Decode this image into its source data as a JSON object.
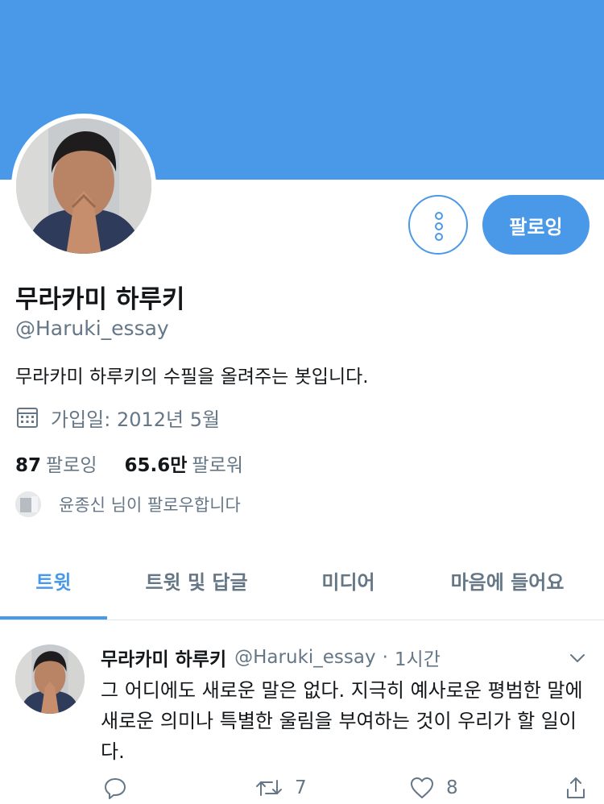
{
  "profile": {
    "name": "무라카미 하루키",
    "handle": "@Haruki_essay",
    "bio": "무라카미 하루키의 수필을 올려주는 봇입니다.",
    "joined": "가입일: 2012년 5월",
    "following_count": "87",
    "following_label": "팔로잉",
    "followers_count": "65.6만",
    "followers_label": "팔로워",
    "followed_by": "윤종신 님이 팔로우합니다"
  },
  "actions": {
    "follow_button": "팔로잉"
  },
  "tabs": [
    {
      "label": "트윗",
      "active": true
    },
    {
      "label": "트윗 및 답글",
      "active": false
    },
    {
      "label": "미디어",
      "active": false
    },
    {
      "label": "마음에 들어요",
      "active": false
    }
  ],
  "tweet": {
    "name": "무라카미 하루키",
    "handle": "@Haruki_essay",
    "separator": "·",
    "time": "1시간",
    "text": "그 어디에도 새로운 말은 없다. 지극히 예사로운 평범한 말에 새로운 의미나 특별한 울림을 부여하는 것이 우리가 할 일이다.",
    "reply_count": "",
    "retweet_count": "7",
    "like_count": "8"
  },
  "icons": {
    "calendar": "calendar-icon",
    "more": "more-vertical-icon",
    "caret": "chevron-down-icon",
    "reply": "reply-icon",
    "retweet": "retweet-icon",
    "like": "heart-icon",
    "share": "share-icon"
  },
  "colors": {
    "accent": "#4a99e9",
    "text_primary": "#14171a",
    "text_secondary": "#657786",
    "divider": "#e1e8ed"
  }
}
